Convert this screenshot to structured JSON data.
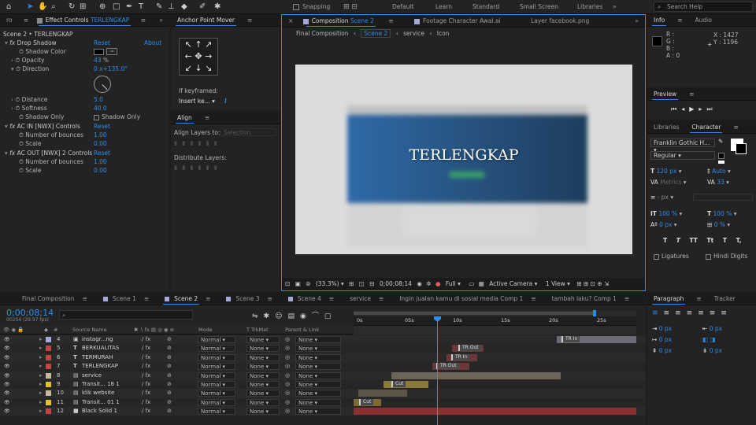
{
  "toolbar": {
    "snapping_label": "Snapping",
    "workspaces": [
      "Default",
      "Learn",
      "Standard",
      "Small Screen",
      "Libraries"
    ],
    "active_workspace": "Standard",
    "search_placeholder": "Search Help"
  },
  "effect_controls": {
    "left_tab": "ro",
    "tab_label": "Effect Controls",
    "tab_layer": "TERLENGKAP",
    "breadcrumb": "Scene 2 • TERLENGKAP",
    "drop_shadow": {
      "name": "Drop Shadow",
      "reset": "Reset",
      "about": "About",
      "props": [
        {
          "label": "Shadow Color",
          "value": ""
        },
        {
          "label": "Opacity",
          "value": "43",
          "unit": "%"
        },
        {
          "label": "Direction",
          "value": "0 x+135.0°"
        },
        {
          "label": "Distance",
          "value": "5.0"
        },
        {
          "label": "Softness",
          "value": "40.0"
        },
        {
          "label": "Shadow Only",
          "value": "Shadow Only"
        }
      ]
    },
    "ac_in": {
      "name": "AC IN [NWX] Controls",
      "reset": "Reset",
      "props": [
        {
          "label": "Number of bounces",
          "value": "1.00"
        },
        {
          "label": "Scale",
          "value": "0.00"
        }
      ]
    },
    "ac_out": {
      "name": "AC OUT [NWX] 2 Controls",
      "reset": "Reset",
      "props": [
        {
          "label": "Number of bounces",
          "value": "1.00"
        },
        {
          "label": "Scale",
          "value": "0.00"
        }
      ]
    }
  },
  "anchor_point": {
    "title": "Anchor Point Mover",
    "if_keyframed": "If keyframed:",
    "mode": "Insert ke..."
  },
  "align": {
    "title": "Align",
    "align_to_label": "Align Layers to:",
    "align_to_value": "Selection",
    "distribute_label": "Distribute Layers:"
  },
  "composition": {
    "tabs": [
      {
        "label": "Composition",
        "sub": "Scene 2"
      },
      {
        "label": "Footage",
        "sub": "Character Awal.ai"
      },
      {
        "label": "Layer",
        "sub": "facebook.png"
      }
    ],
    "breadcrumbs": [
      "Final Composition",
      "Scene 2",
      "service",
      "Icon"
    ],
    "canvas_text": "TERLENGKAP",
    "footer": {
      "zoom": "(33.3%)",
      "timecode": "0;00;08;14",
      "resolution": "Full",
      "camera": "Active Camera",
      "view": "1 View"
    }
  },
  "info": {
    "tabs": [
      "Info",
      "Audio"
    ],
    "channels": [
      "R :",
      "G :",
      "B :",
      "A : 0"
    ],
    "x": "X : 1427",
    "y": "Y : 1196"
  },
  "preview": {
    "title": "Preview"
  },
  "character": {
    "tabs": [
      "Libraries",
      "Character"
    ],
    "font": "Franklin Gothic H...",
    "style": "Regular",
    "size": "120 px",
    "leading": "Auto",
    "kerning": "Metrics",
    "tracking": "33",
    "stroke": "- px",
    "v_scale": "100 %",
    "h_scale": "100 %",
    "baseline": "0 px",
    "tsume": "0 %",
    "style_buttons": [
      "T",
      "T",
      "TT",
      "Tt",
      "T",
      "T,"
    ],
    "ligatures": "Ligatures",
    "hindi": "Hindi Digits"
  },
  "paragraph": {
    "tabs": [
      "Paragraph",
      "Tracker"
    ],
    "values": [
      "0 px",
      "0 px",
      "0 px",
      "0 px",
      "0 px"
    ]
  },
  "timeline": {
    "tabs": [
      "Final Composition",
      "Scene 1",
      "Scene 2",
      "Scene 3",
      "Scene 4",
      "service",
      "Ingin jualan kamu di sosial media Comp 1",
      "tambah laku? Comp 1"
    ],
    "active_tab": "Scene 2",
    "timecode": "0;00;08;14",
    "frames": "00254 (29.97 fps)",
    "columns": [
      "#",
      "Source Name",
      "Mode",
      "T TrkMat",
      "Parent & Link"
    ],
    "ruler": [
      "0s",
      "05s",
      "10s",
      "15s",
      "20s",
      "25s"
    ],
    "layers": [
      {
        "num": "4",
        "name": "instagr...ng",
        "type": "img",
        "color": "#a5a8d8",
        "mode": "Normal",
        "trk": "None",
        "parent": "None"
      },
      {
        "num": "5",
        "name": "BERKUALITAS",
        "type": "T",
        "color": "#c24545",
        "mode": "Normal",
        "trk": "None",
        "parent": "None"
      },
      {
        "num": "6",
        "name": "TERMURAH",
        "type": "T",
        "color": "#c24545",
        "mode": "Normal",
        "trk": "None",
        "parent": "None"
      },
      {
        "num": "7",
        "name": "TERLENGKAP",
        "type": "T",
        "color": "#c24545",
        "mode": "Normal",
        "trk": "None",
        "parent": "None"
      },
      {
        "num": "8",
        "name": "service",
        "type": "comp",
        "color": "#c7b8a0",
        "mode": "Normal",
        "trk": "None",
        "parent": "None"
      },
      {
        "num": "9",
        "name": "Transit... 18 1",
        "type": "comp",
        "color": "#e2c12f",
        "mode": "Normal",
        "trk": "None",
        "parent": "None"
      },
      {
        "num": "10",
        "name": "klik website",
        "type": "comp",
        "color": "#c7b8a0",
        "mode": "Normal",
        "trk": "None",
        "parent": "None"
      },
      {
        "num": "11",
        "name": "Transit... 01 1",
        "type": "comp",
        "color": "#e2c12f",
        "mode": "Normal",
        "trk": "None",
        "parent": "None"
      },
      {
        "num": "12",
        "name": "Black Solid 1",
        "type": "solid",
        "color": "#c24545",
        "mode": "Normal",
        "trk": "None",
        "parent": "None"
      }
    ],
    "markers": [
      "TR In",
      "TR Out",
      "TR In",
      "TR Out",
      "Cut",
      "Cut"
    ]
  }
}
